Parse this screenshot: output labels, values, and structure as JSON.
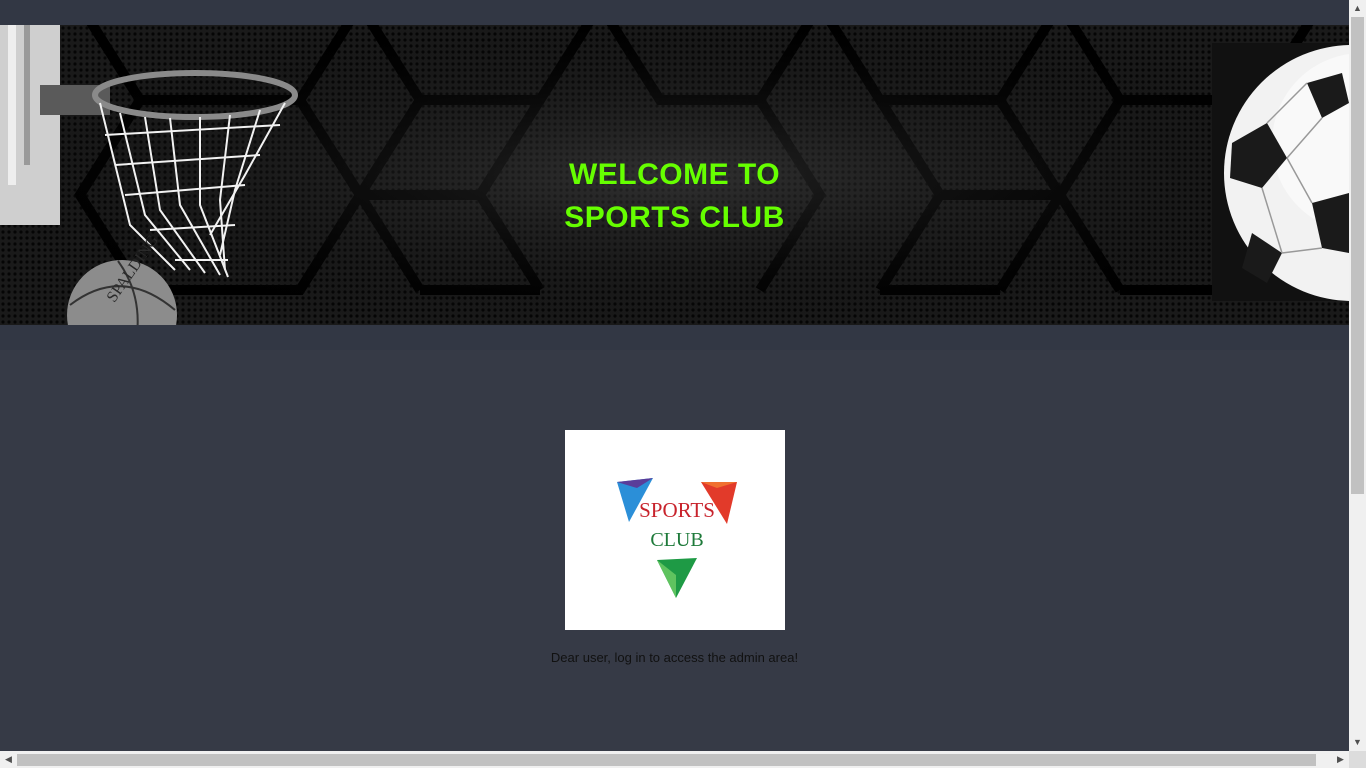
{
  "banner": {
    "title_line1": "WELCOME TO",
    "title_line2": "SPORTS CLUB",
    "title_color": "#66ff00"
  },
  "logo": {
    "text_line1": "SPORTS",
    "text_line2": "CLUB"
  },
  "main": {
    "message": "Dear user, log in to access the admin area!"
  },
  "colors": {
    "page_background": "#363a46",
    "bar_background": "#323744"
  },
  "icons": {
    "scroll_up": "▲",
    "scroll_down": "▼",
    "scroll_left": "◀",
    "scroll_right": "▶"
  }
}
